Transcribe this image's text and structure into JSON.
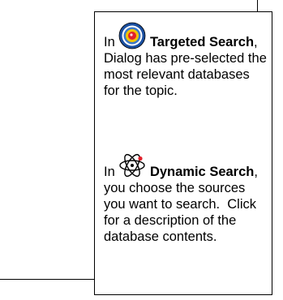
{
  "callout": {
    "targeted": {
      "prefix": "In ",
      "title": "Targeted Search",
      "comma": ",",
      "line_2": "Dialog has pre-selected the",
      "line_3": "most relevant databases",
      "line_4": "for the topic.",
      "icon": "target-icon"
    },
    "dynamic": {
      "prefix": "In ",
      "title": "Dynamic Search",
      "comma": ",",
      "line_2": "you choose the sources",
      "line_3": "you want to search.  Click",
      "line_4": "for a description of the",
      "line_5": "database contents.",
      "icon": "atom-icon"
    }
  },
  "colors": {
    "target_outer": "#1a4fa0",
    "target_ring": "#f2c400",
    "target_center": "#e2202b",
    "atom_dot": "#e2202b"
  }
}
